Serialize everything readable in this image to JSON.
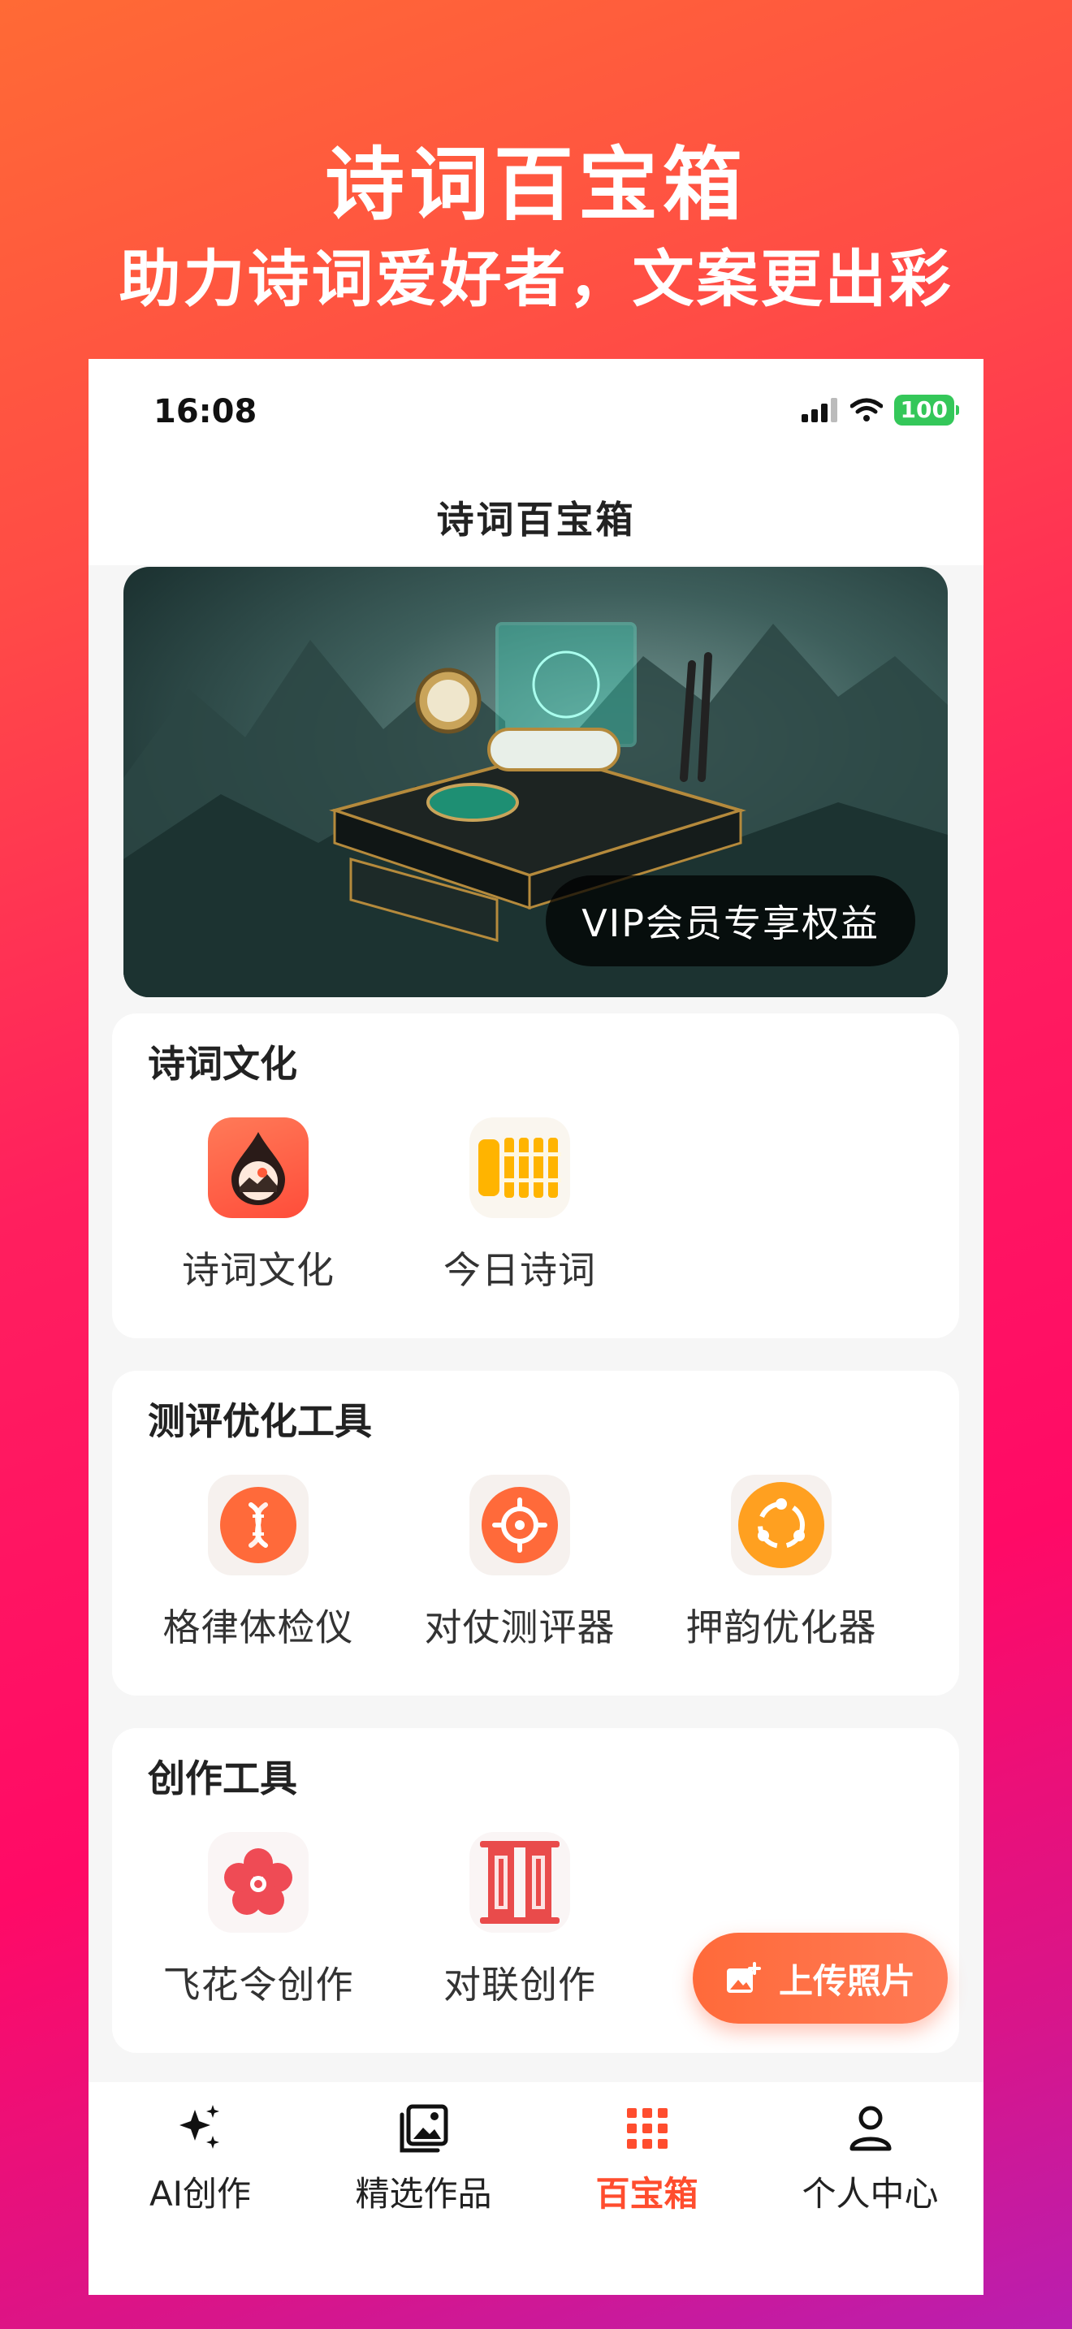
{
  "promo": {
    "title": "诗词百宝箱",
    "subtitle": "助力诗词爱好者，文案更出彩"
  },
  "status_bar": {
    "time": "16:08",
    "battery": "100"
  },
  "header": {
    "title": "诗词百宝箱"
  },
  "banner": {
    "badge": "VIP会员专享权益"
  },
  "sections": [
    {
      "title": "诗词文化",
      "items": [
        {
          "label": "诗词文化",
          "icon": "ink-drop-landscape-icon"
        },
        {
          "label": "今日诗词",
          "icon": "bamboo-scroll-icon"
        }
      ]
    },
    {
      "title": "测评优化工具",
      "items": [
        {
          "label": "格律体检仪",
          "icon": "dna-icon"
        },
        {
          "label": "对仗测评器",
          "icon": "target-icon"
        },
        {
          "label": "押韵优化器",
          "icon": "share-cycle-icon"
        }
      ]
    },
    {
      "title": "创作工具",
      "items": [
        {
          "label": "飞花令创作",
          "icon": "flower-icon"
        },
        {
          "label": "对联创作",
          "icon": "couplet-scroll-icon"
        }
      ]
    }
  ],
  "upload_button": {
    "label": "上传照片"
  },
  "tabs": [
    {
      "label": "AI创作",
      "icon": "sparkle-icon",
      "active": false
    },
    {
      "label": "精选作品",
      "icon": "gallery-icon",
      "active": false
    },
    {
      "label": "百宝箱",
      "icon": "grid-icon",
      "active": true
    },
    {
      "label": "个人中心",
      "icon": "person-icon",
      "active": false
    }
  ],
  "colors": {
    "accent": "#ff4d2e",
    "battery": "#34c759"
  }
}
